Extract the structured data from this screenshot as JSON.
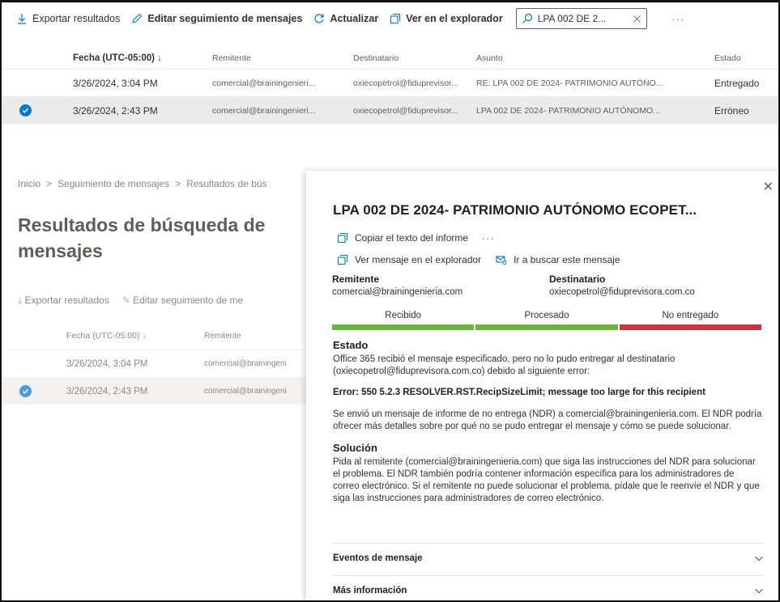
{
  "toolbar": {
    "export_label": "Exportar resultados",
    "edit_label": "Editar seguimiento de mensajes",
    "refresh_label": "Actualizar",
    "explorer_label": "Ver en el explorador",
    "search_value": "LPA 002 DE 2...",
    "more_label": "···"
  },
  "results_table": {
    "headers": {
      "date": "Fecha (UTC-05:00) ↓",
      "sender": "Remitente",
      "recipient": "Destinatario",
      "subject": "Asunto",
      "status": "Estado"
    },
    "rows": [
      {
        "date": "3/26/2024, 3:04 PM",
        "sender": "comercial@brainingenieri...",
        "recipient": "oxiecopetrol@fiduprevisor...",
        "subject": "RE: LPA 002 DE 2024- PATRIMONIO AUTÓNO...",
        "status": "Entregado"
      },
      {
        "date": "3/26/2024, 2:43 PM",
        "sender": "comercial@brainingenieri...",
        "recipient": "oxiecopetrol@fiduprevisor...",
        "subject": "LPA 002 DE 2024- PATRIMONIO AUTÓNOMO...",
        "status": "Erróneo"
      }
    ]
  },
  "background_page": {
    "breadcrumb": [
      "Inicio",
      ">",
      "Seguimiento de mensajes",
      ">",
      "Resultados de bús"
    ],
    "title": "Resultados de búsqueda de mensajes",
    "title_line1": "Resultados de búsqueda de",
    "title_line2": "mensajes",
    "export_label": "Exportar resultados",
    "edit_label": "Editar seguimiento de me",
    "headers": {
      "date": "Fecha (UTC-05:00) ↓",
      "sender": "Remitente"
    },
    "rows": [
      {
        "date": "3/26/2024, 3:04 PM",
        "sender": "comercial@brainingeni"
      },
      {
        "date": "3/26/2024, 2:43 PM",
        "sender": "comercial@brainingeni"
      }
    ]
  },
  "panel": {
    "title": "LPA 002 DE 2024- PATRIMONIO AUTÓNOMO ECOPET...",
    "copy_label": "Copiar el texto del informe",
    "more_label": "···",
    "view_explorer_label": "Ver mensaje en el explorador",
    "find_message_label": "Ir a buscar este mensaje",
    "sender_label": "Remitente",
    "sender_value": "comercial@brainingenieria.com",
    "recipient_label": "Destinatario",
    "recipient_value": "oxiecopetrol@fiduprevisora.com.co",
    "stages": [
      {
        "label": "Recibido",
        "color": "#6bb43f"
      },
      {
        "label": "Procesado",
        "color": "#6bb43f"
      },
      {
        "label": "No entregado",
        "color": "#d13438"
      }
    ],
    "status_heading": "Estado",
    "status_text": "Office 365 recibió el mensaje especificado, pero no lo pudo entregar al destinatario (oxiecopetrol@fiduprevisora.com.co) debido al siguiente error:",
    "error_text": "Error: 550 5.2.3 RESOLVER.RST.RecipSizeLimit; message too large for this recipient",
    "ndr_text": "Se envió un mensaje de informe de no entrega (NDR) a comercial@brainingenieria.com. El NDR podría ofrecer más detalles sobre por qué no se pudo entregar el mensaje y cómo se puede solucionar.",
    "solution_heading": "Solución",
    "solution_text": "Pida al remitente (comercial@brainingenieria.com) que siga las instrucciones del NDR para solucionar el problema. El NDR también podría contener información específica para los administradores de correo electrónico. Si el remitente no puede solucionar el problema, pídale que le reenvíe el NDR y que siga las instrucciones para administradores de correo electrónico.",
    "events_label": "Eventos de mensaje",
    "more_info_label": "Más información"
  },
  "colors": {
    "accent": "#0078d4",
    "success": "#6bb43f",
    "error": "#d13438"
  }
}
